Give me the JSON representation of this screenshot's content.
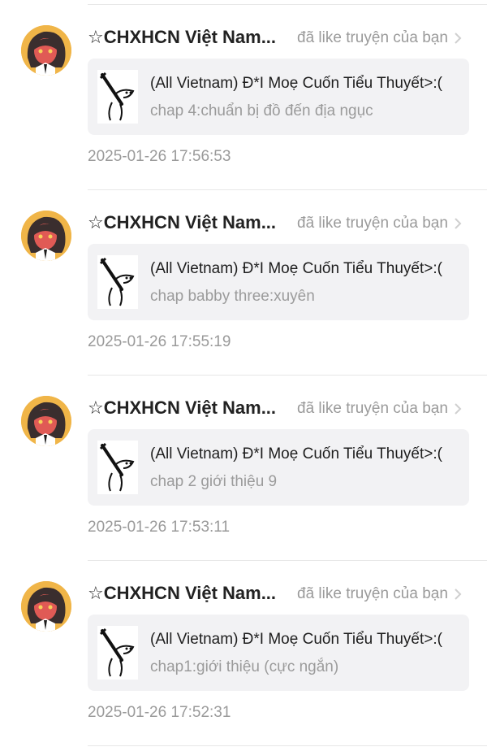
{
  "notifications": [
    {
      "user_name": "☆CHXHCN Việt Nam...",
      "action_text": "đã like truyện của bạn",
      "story_title": "(All Vietnam) Đ*I Moẹ Cuốn Tiểu Thuyết>:(",
      "chapter": "chap 4:chuẩn bị đồ đến địa ngục",
      "timestamp": "2025-01-26 17:56:53"
    },
    {
      "user_name": "☆CHXHCN Việt Nam...",
      "action_text": "đã like truyện của bạn",
      "story_title": "(All Vietnam) Đ*I Moẹ Cuốn Tiểu Thuyết>:(",
      "chapter": "chap babby three:xuyên",
      "timestamp": "2025-01-26 17:55:19"
    },
    {
      "user_name": "☆CHXHCN Việt Nam...",
      "action_text": "đã like truyện của bạn",
      "story_title": "(All Vietnam) Đ*I Moẹ Cuốn Tiểu Thuyết>:(",
      "chapter": "chap 2 giới thiệu 9",
      "timestamp": "2025-01-26 17:53:11"
    },
    {
      "user_name": "☆CHXHCN Việt Nam...",
      "action_text": "đã like truyện của bạn",
      "story_title": "(All Vietnam) Đ*I Moẹ Cuốn Tiểu Thuyết>:(",
      "chapter": "chap1:giới thiệu (cực ngắn)",
      "timestamp": "2025-01-26 17:52:31"
    }
  ],
  "icons": {
    "avatar": "avatar-image",
    "thumbnail": "story-cover-thumbnail",
    "chevron": "chevron-right-icon"
  },
  "colors": {
    "card_bg": "#f2f2f4",
    "secondary_text": "#9a9a9a",
    "primary_text": "#222222"
  }
}
